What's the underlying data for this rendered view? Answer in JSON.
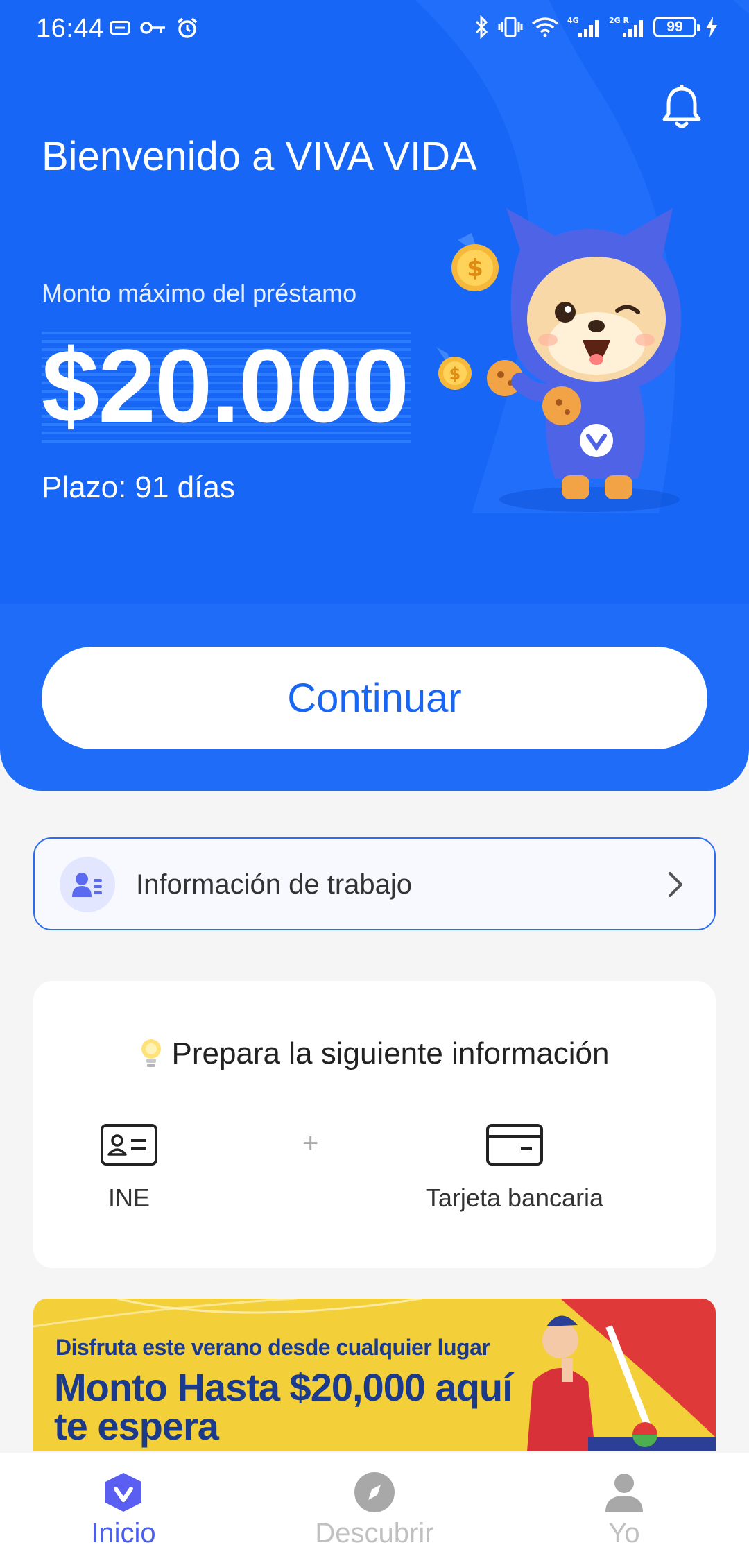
{
  "status_bar": {
    "time": "16:44",
    "battery": "99"
  },
  "header": {
    "welcome": "Bienvenido a VIVA VIDA"
  },
  "loan": {
    "max_label": "Monto máximo del préstamo",
    "amount": "$20.000",
    "term": "Plazo: 91 días",
    "continue_label": "Continuar"
  },
  "work_info": {
    "label": "Información de trabajo"
  },
  "prepare": {
    "title": "Prepara la siguiente información",
    "items": [
      {
        "label": "INE",
        "icon": "id-card-icon"
      },
      {
        "label": "Tarjeta bancaria",
        "icon": "bank-card-icon"
      }
    ],
    "separator": "+"
  },
  "banner": {
    "subtitle": "Disfruta este verano desde cualquier lugar",
    "title": "Monto Hasta $20,000 aquí te espera"
  },
  "bottom_nav": {
    "items": [
      {
        "label": "Inicio",
        "icon": "home-logo-icon",
        "active": true
      },
      {
        "label": "Descubrir",
        "icon": "compass-icon",
        "active": false
      },
      {
        "label": "Yo",
        "icon": "person-icon",
        "active": false
      }
    ]
  },
  "colors": {
    "primary": "#1766f5",
    "hero_lower": "#1e6cf8",
    "banner_bg": "#f3cf3a",
    "banner_text": "#1c3a8c",
    "nav_active": "#4a5ef0",
    "nav_inactive": "#b0b0b0"
  }
}
